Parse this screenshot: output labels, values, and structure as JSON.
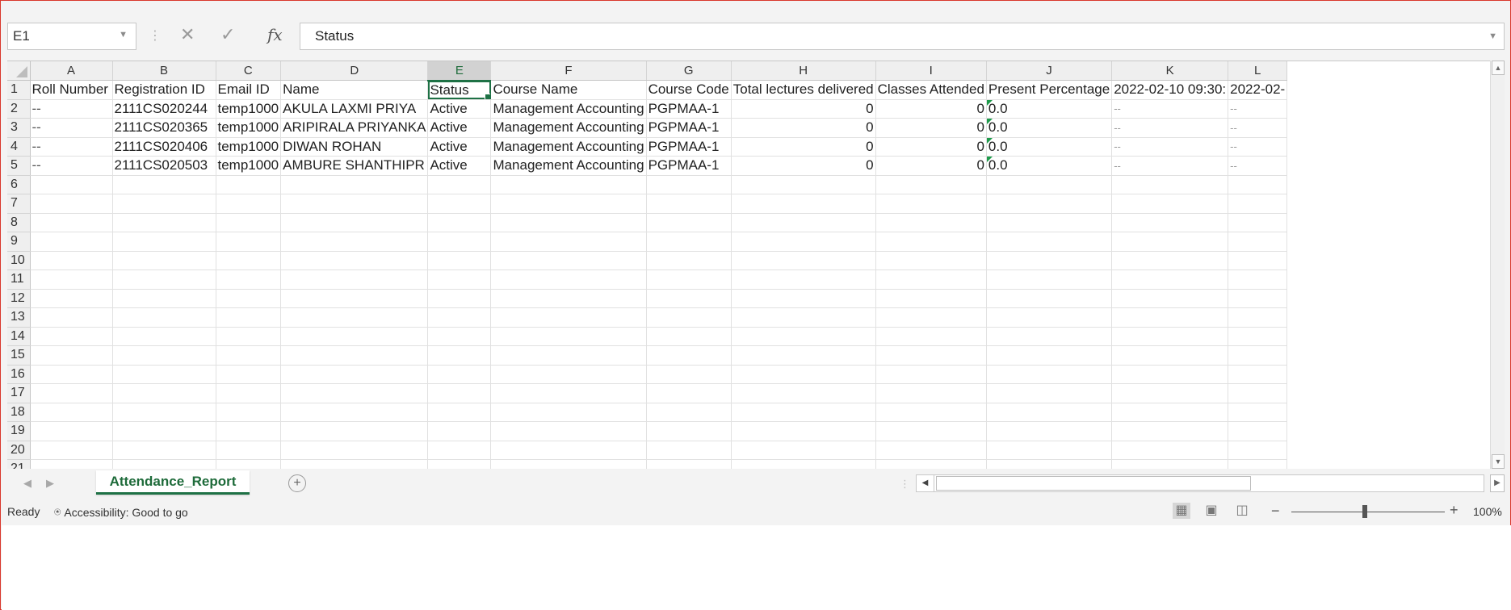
{
  "formula_bar": {
    "name_box": "E1",
    "cancel_icon": "✕",
    "enter_icon": "✓",
    "fx_label": "fx",
    "content": "Status"
  },
  "columns": [
    "A",
    "B",
    "C",
    "D",
    "E",
    "F",
    "G",
    "H",
    "I",
    "J",
    "K",
    "L"
  ],
  "active_column": "E",
  "row_numbers": [
    "1",
    "2",
    "3",
    "4",
    "5",
    "6",
    "7",
    "8",
    "9",
    "10",
    "11",
    "12",
    "13",
    "14",
    "15",
    "16",
    "17",
    "18",
    "19",
    "20",
    "21"
  ],
  "header_row": [
    "Roll Number",
    "Registration ID",
    "Email ID",
    "Name",
    "Status",
    "Course Name",
    "Course Code",
    "Total lectures delivered",
    "Classes Attended",
    "Present Percentage",
    "2022-02-10 09:30:",
    "2022-02-"
  ],
  "data_rows": [
    [
      "--",
      "2111CS020244",
      "temp1000",
      "AKULA LAXMI  PRIYA",
      "Active",
      "Management Accounting",
      "PGPMAA-1",
      "0",
      "0",
      "0.0",
      "--",
      "--"
    ],
    [
      "--",
      "2111CS020365",
      "temp1000",
      "ARIPIRALA  PRIYANKA",
      "Active",
      "Management Accounting",
      "PGPMAA-1",
      "0",
      "0",
      "0.0",
      "--",
      "--"
    ],
    [
      "--",
      "2111CS020406",
      "temp1000",
      "DIWAN  ROHAN",
      "Active",
      "Management Accounting",
      "PGPMAA-1",
      "0",
      "0",
      "0.0",
      "--",
      "--"
    ],
    [
      "--",
      "2111CS020503",
      "temp1000",
      "AMBURE  SHANTHIPR",
      "Active",
      "Management Accounting",
      "PGPMAA-1",
      "0",
      "0",
      "0.0",
      "--",
      "--"
    ]
  ],
  "sheet_tab": "Attendance_Report",
  "add_sheet_icon": "+",
  "status": {
    "ready": "Ready",
    "accessibility": "Accessibility: Good to go",
    "zoom": "100%"
  },
  "colors": {
    "accent": "#1e7145",
    "frame_border": "#d9362b"
  }
}
